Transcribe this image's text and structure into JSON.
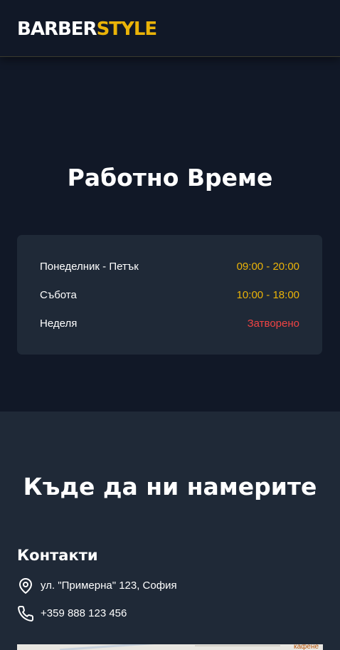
{
  "header": {
    "logo_part1": "BARBER",
    "logo_part2": "STYLE"
  },
  "hours": {
    "title": "Работно Време",
    "rows": [
      {
        "day": "Понеделник - Петък",
        "time": "09:00 - 20:00",
        "status": "open"
      },
      {
        "day": "Събота",
        "time": "10:00 - 18:00",
        "status": "open"
      },
      {
        "day": "Неделя",
        "time": "Затворено",
        "status": "closed"
      }
    ]
  },
  "location": {
    "title": "Къде да ни намерите",
    "contacts_title": "Контакти",
    "address": "ул. \"Примерна\" 123, София",
    "phone": "+359 888 123 456",
    "map_label": "кафене"
  },
  "colors": {
    "background": "#111827",
    "card": "#1f2937",
    "accent": "#eab308",
    "closed": "#ef4444",
    "text": "#ffffff"
  },
  "icons": {
    "address": "map-pin-icon",
    "phone": "phone-icon"
  }
}
